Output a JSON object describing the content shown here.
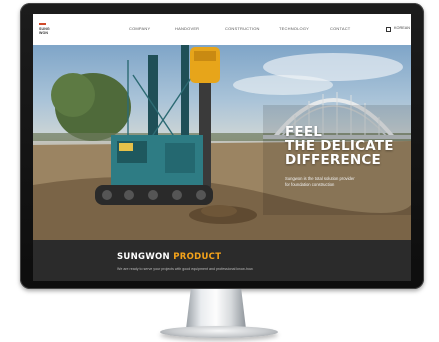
{
  "site": {
    "logo": {
      "line1": "SUNG",
      "line2": "WON"
    },
    "nav": [
      "COMPANY",
      "HANDOVER",
      "CONSTRUCTION",
      "TECHNOLOGY",
      "CONTACT"
    ],
    "lang": "KOREAN"
  },
  "hero": {
    "line1": "FEEL",
    "line2": "THE DELICATE",
    "line3": "DIFFERENCE",
    "sub1": "Sungwon is the total solution provider",
    "sub2": "for foundation construction"
  },
  "product": {
    "title_a": "SUNGWON",
    "title_b": "PRODUCT",
    "desc": "We are ready to serve your projects with good equipment and professional know-how."
  },
  "colors": {
    "accent": "#f5a31a",
    "brand": "#d04b2b",
    "bar": "#2b2b2b"
  }
}
